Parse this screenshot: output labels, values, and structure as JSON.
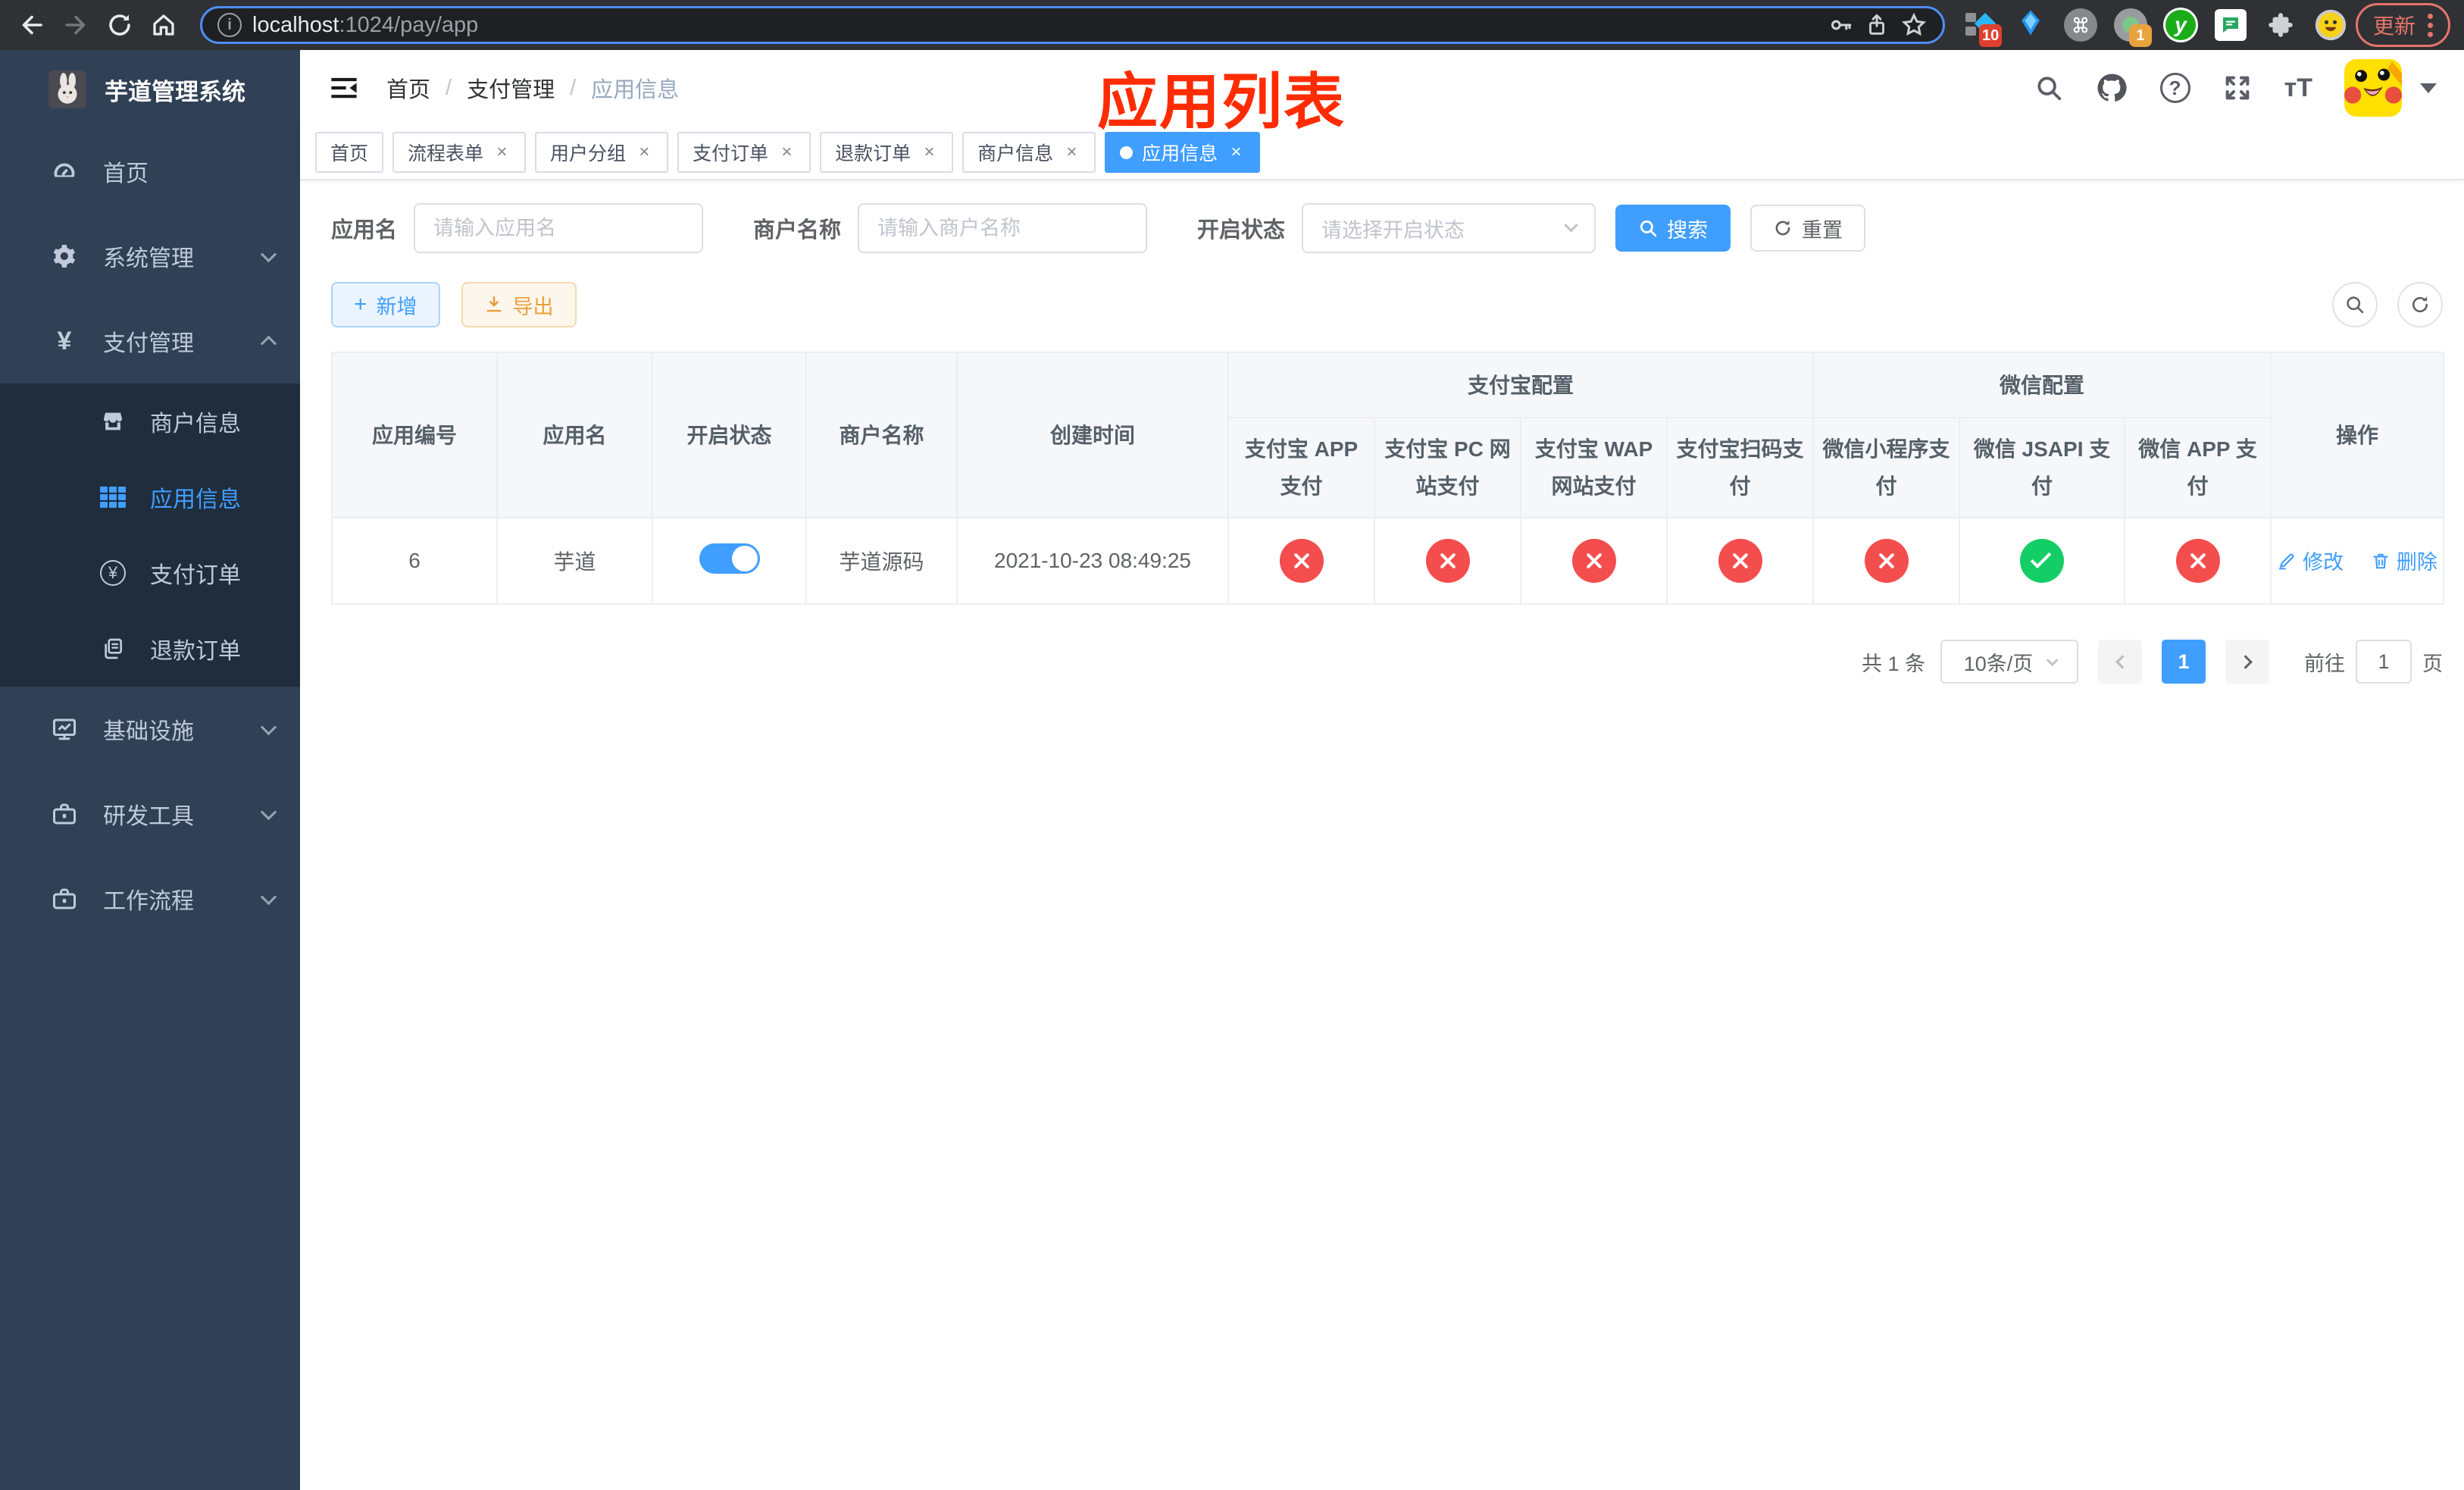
{
  "browser": {
    "url_host": "localhost",
    "url_rest": ":1024/pay/app",
    "ext_badge_blue_diamond": "10",
    "ext_badge_circle": "1",
    "update_label": "更新"
  },
  "sidebar": {
    "title": "芋道管理系统",
    "items": [
      {
        "label": "首页"
      },
      {
        "label": "系统管理"
      },
      {
        "label": "支付管理"
      },
      {
        "label": "商户信息"
      },
      {
        "label": "应用信息"
      },
      {
        "label": "支付订单"
      },
      {
        "label": "退款订单"
      },
      {
        "label": "基础设施"
      },
      {
        "label": "研发工具"
      },
      {
        "label": "工作流程"
      }
    ]
  },
  "breadcrumb": [
    "首页",
    "支付管理",
    "应用信息"
  ],
  "annotation": {
    "title": "应用列表"
  },
  "tabs": [
    {
      "label": "首页"
    },
    {
      "label": "流程表单"
    },
    {
      "label": "用户分组"
    },
    {
      "label": "支付订单"
    },
    {
      "label": "退款订单"
    },
    {
      "label": "商户信息"
    },
    {
      "label": "应用信息"
    }
  ],
  "filters": {
    "app_name_label": "应用名",
    "app_name_placeholder": "请输入应用名",
    "merchant_label": "商户名称",
    "merchant_placeholder": "请输入商户名称",
    "status_label": "开启状态",
    "status_placeholder": "请选择开启状态",
    "search_label": "搜索",
    "reset_label": "重置"
  },
  "toolbar": {
    "add_label": "新增",
    "export_label": "导出"
  },
  "table": {
    "group_alipay": "支付宝配置",
    "group_wechat": "微信配置",
    "columns": [
      "应用编号",
      "应用名",
      "开启状态",
      "商户名称",
      "创建时间",
      "支付宝 APP 支付",
      "支付宝 PC 网站支付",
      "支付宝 WAP 网站支付",
      "支付宝扫码支付",
      "微信小程序支付",
      "微信 JSAPI 支付",
      "微信 APP 支付",
      "操作"
    ],
    "rows": [
      {
        "id": "6",
        "name": "芋道",
        "enabled": "on",
        "merchant": "芋道源码",
        "created_at": "2021-10-23 08:49:25",
        "channels": [
          "off",
          "off",
          "off",
          "off",
          "off",
          "on",
          "off"
        ],
        "edit_label": "修改",
        "delete_label": "删除"
      }
    ]
  },
  "pagination": {
    "total_text": "共 1 条",
    "page_size": "10条/页",
    "current_page": "1",
    "goto_label": "前往",
    "goto_value": "1",
    "page_suffix": "页"
  }
}
